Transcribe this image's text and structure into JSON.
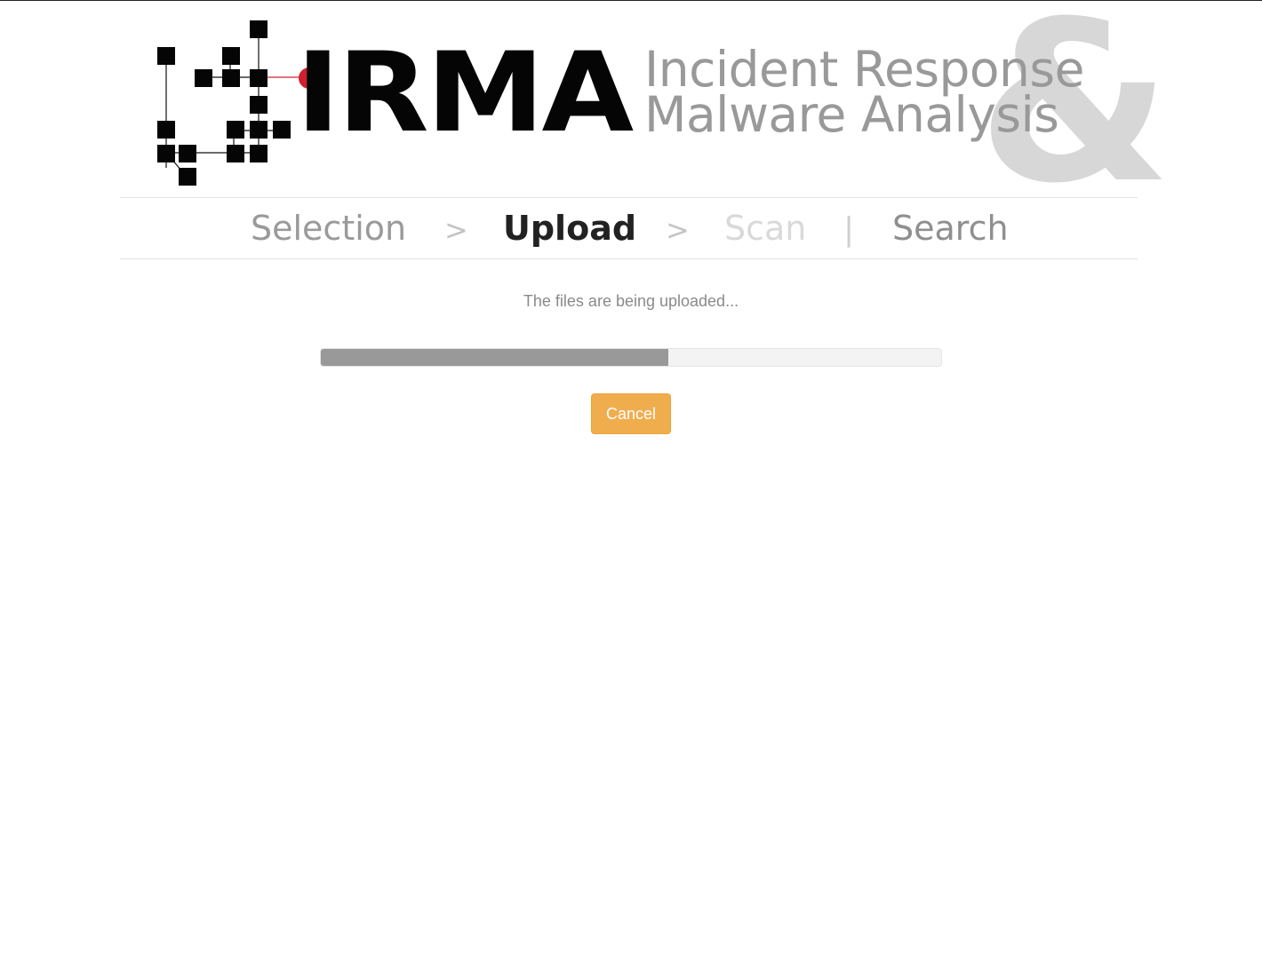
{
  "header": {
    "logo_text": "IRMA",
    "tagline_line1": "Incident Response",
    "tagline_line2": "Malware Analysis",
    "ampersand": "&"
  },
  "steps": {
    "items": [
      {
        "label": "Selection",
        "state": "done"
      },
      {
        "label": "Upload",
        "state": "active"
      },
      {
        "label": "Scan",
        "state": "pending"
      },
      {
        "label": "Search",
        "state": "available"
      }
    ],
    "separators": [
      ">",
      ">",
      "|"
    ]
  },
  "upload": {
    "status_text": "The files are being uploaded...",
    "progress_fraction": 0.56,
    "cancel_label": "Cancel"
  },
  "colors": {
    "accent_button": "#f0ad4e",
    "progress_fill": "#999999",
    "logo_dot": "#d0202e"
  }
}
